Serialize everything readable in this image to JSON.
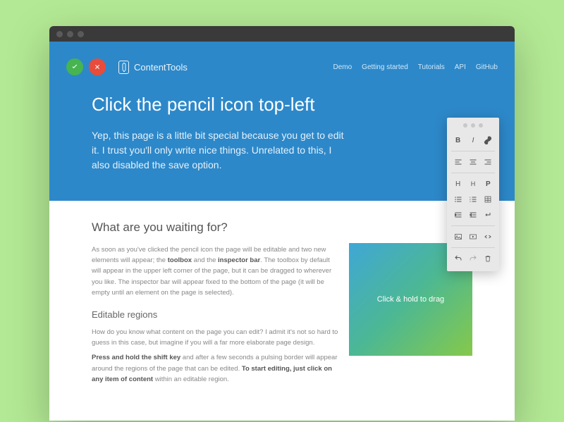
{
  "brand": "ContentTools",
  "nav": [
    "Demo",
    "Getting started",
    "Tutorials",
    "API",
    "GitHub"
  ],
  "hero": {
    "title": "Click the pencil icon top-left",
    "lead": "Yep, this page is a little bit special because you get to edit it. I trust you'll only write nice things. Unrelated to this, I also disabled the save option."
  },
  "body": {
    "h2": "What are you waiting for?",
    "p1a": "As soon as you've clicked the pencil icon the page will be editable and two new elements will appear; the ",
    "p1b": "toolbox",
    "p1c": " and the ",
    "p1d": "inspector bar",
    "p1e": ". The toolbox by default will appear in the upper left corner of the page, but it can be dragged to wherever you like. The inspector bar will appear fixed to the bottom of the page (it will be empty until an element on the page is selected).",
    "h3": "Editable regions",
    "p2": "How do you know what content on the page you can edit? I admit it's not so hard to guess in this case, but imagine if you will a far more elaborate page design.",
    "p3a": "Press and hold the shift key",
    "p3b": " and after a few seconds a pulsing border will appear around the regions of the page that can be edited. ",
    "p3c": "To start editing, just click on any item of content",
    "p3d": " within an editable region."
  },
  "drag_label": "Click & hold to drag",
  "toolbox": {
    "bold": "B",
    "italic": "I",
    "h1": "H",
    "h2": "H",
    "p": "P"
  }
}
